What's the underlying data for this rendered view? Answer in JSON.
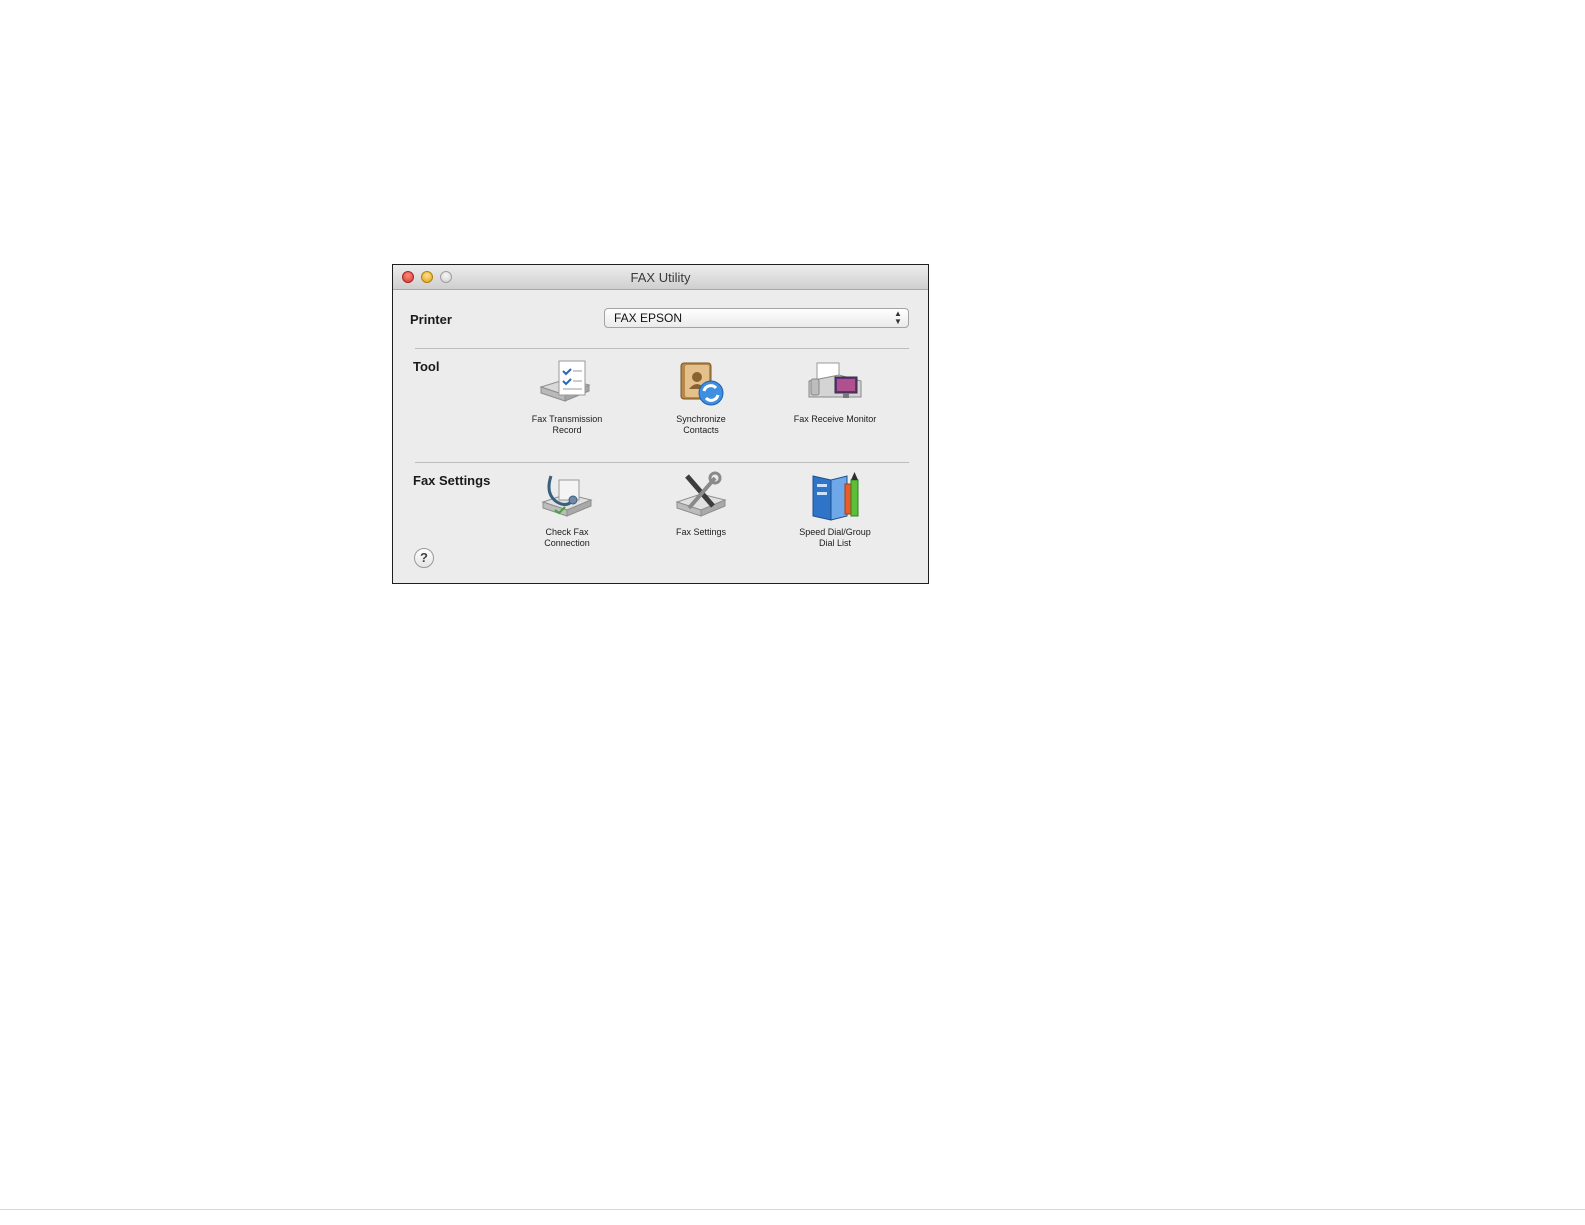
{
  "window": {
    "title": "FAX Utility",
    "traffic_lights": [
      "close-button",
      "minimize-button",
      "zoom-button"
    ]
  },
  "printer": {
    "label": "Printer",
    "selected": "FAX EPSON",
    "arrows": "▲\n▼"
  },
  "sections": {
    "tool_label": "Tool",
    "fax_settings_label": "Fax Settings"
  },
  "tools": [
    {
      "label": "Fax Transmission\nRecord",
      "icon": "fax-transmission-record-icon"
    },
    {
      "label": "Synchronize\nContacts",
      "icon": "synchronize-contacts-icon"
    },
    {
      "label": "Fax Receive Monitor",
      "icon": "fax-receive-monitor-icon"
    }
  ],
  "fax_settings": [
    {
      "label": "Check Fax\nConnection",
      "icon": "check-fax-connection-icon"
    },
    {
      "label": "Fax Settings",
      "icon": "fax-settings-icon"
    },
    {
      "label": "Speed Dial/Group\nDial List",
      "icon": "speed-dial-list-icon"
    }
  ],
  "help": {
    "label": "?"
  }
}
